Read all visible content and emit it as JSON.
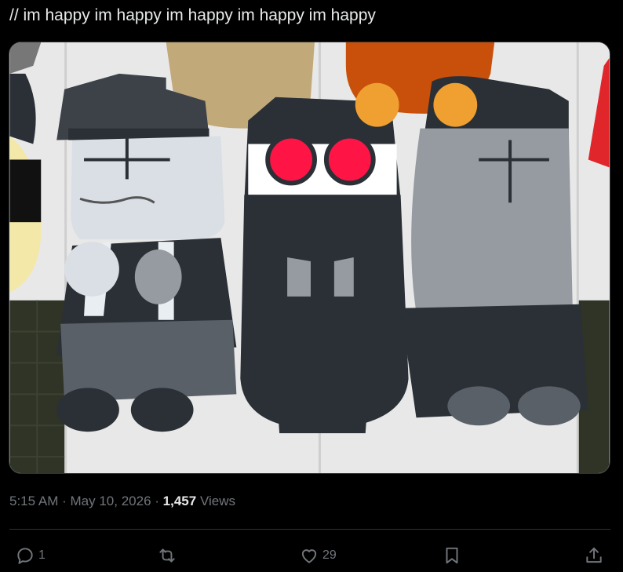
{
  "post": {
    "text": "// im happy im happy im happy im happy im happy"
  },
  "media": {
    "image_kind": "illustration",
    "colors": {
      "background": "#e6e6e6",
      "dark": "#2a3036",
      "gray_light": "#d9dfe4",
      "gray_mid": "#959ba1",
      "red_eyes": "#ff1446",
      "orange_hair": "#c8500a",
      "tan_hair": "#c2a97a",
      "yellow_character": "#f4e8a8"
    }
  },
  "meta": {
    "time": "5:15 AM",
    "separator": "·",
    "date": "May 10, 2026",
    "views_count": "1,457",
    "views_label": "Views"
  },
  "actions": {
    "reply_icon": "reply-icon",
    "reply_count": "1",
    "repost_icon": "repost-icon",
    "like_icon": "heart-icon",
    "like_count": "29",
    "bookmark_icon": "bookmark-icon",
    "share_icon": "share-icon"
  },
  "theme": {
    "background": "#000000",
    "text_primary": "#e7e9ea",
    "text_secondary": "#71767b",
    "divider": "#2f3336"
  }
}
